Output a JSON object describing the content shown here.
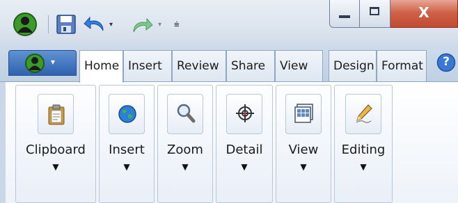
{
  "quick_access": {
    "items": [
      {
        "name": "app-logo-icon"
      },
      {
        "name": "save-icon"
      },
      {
        "name": "undo-icon"
      },
      {
        "name": "redo-icon"
      },
      {
        "name": "customize-qat-icon"
      }
    ],
    "undo_dropdown": "▾",
    "redo_dropdown": "▾",
    "customize": "⩧"
  },
  "window_controls": {
    "minimize": "—",
    "maximize": "▫",
    "close": "X"
  },
  "tabs": [
    {
      "label": "Home",
      "active": true
    },
    {
      "label": "Insert",
      "active": false
    },
    {
      "label": "Review",
      "active": false
    },
    {
      "label": "Share",
      "active": false
    },
    {
      "label": "View",
      "active": false
    },
    {
      "label": "Design",
      "active": false
    },
    {
      "label": "Format",
      "active": false
    }
  ],
  "app_button": {
    "arrow": "▾"
  },
  "help": {
    "glyph": "?"
  },
  "ribbon": {
    "groups": [
      {
        "label": "Clipboard",
        "icon": "clipboard-icon",
        "arrow": "▼"
      },
      {
        "label": "Insert",
        "icon": "globe-icon",
        "arrow": "▼"
      },
      {
        "label": "Zoom",
        "icon": "magnifier-icon",
        "arrow": "▼"
      },
      {
        "label": "Detail",
        "icon": "target-icon",
        "arrow": "▼"
      },
      {
        "label": "View",
        "icon": "view-grid-icon",
        "arrow": "▼"
      },
      {
        "label": "Editing",
        "icon": "pencil-icon",
        "arrow": "▼"
      }
    ]
  },
  "colors": {
    "accent": "#2f62b0",
    "close_red": "#c24a30",
    "ribbon_border": "#8fa5c0"
  }
}
